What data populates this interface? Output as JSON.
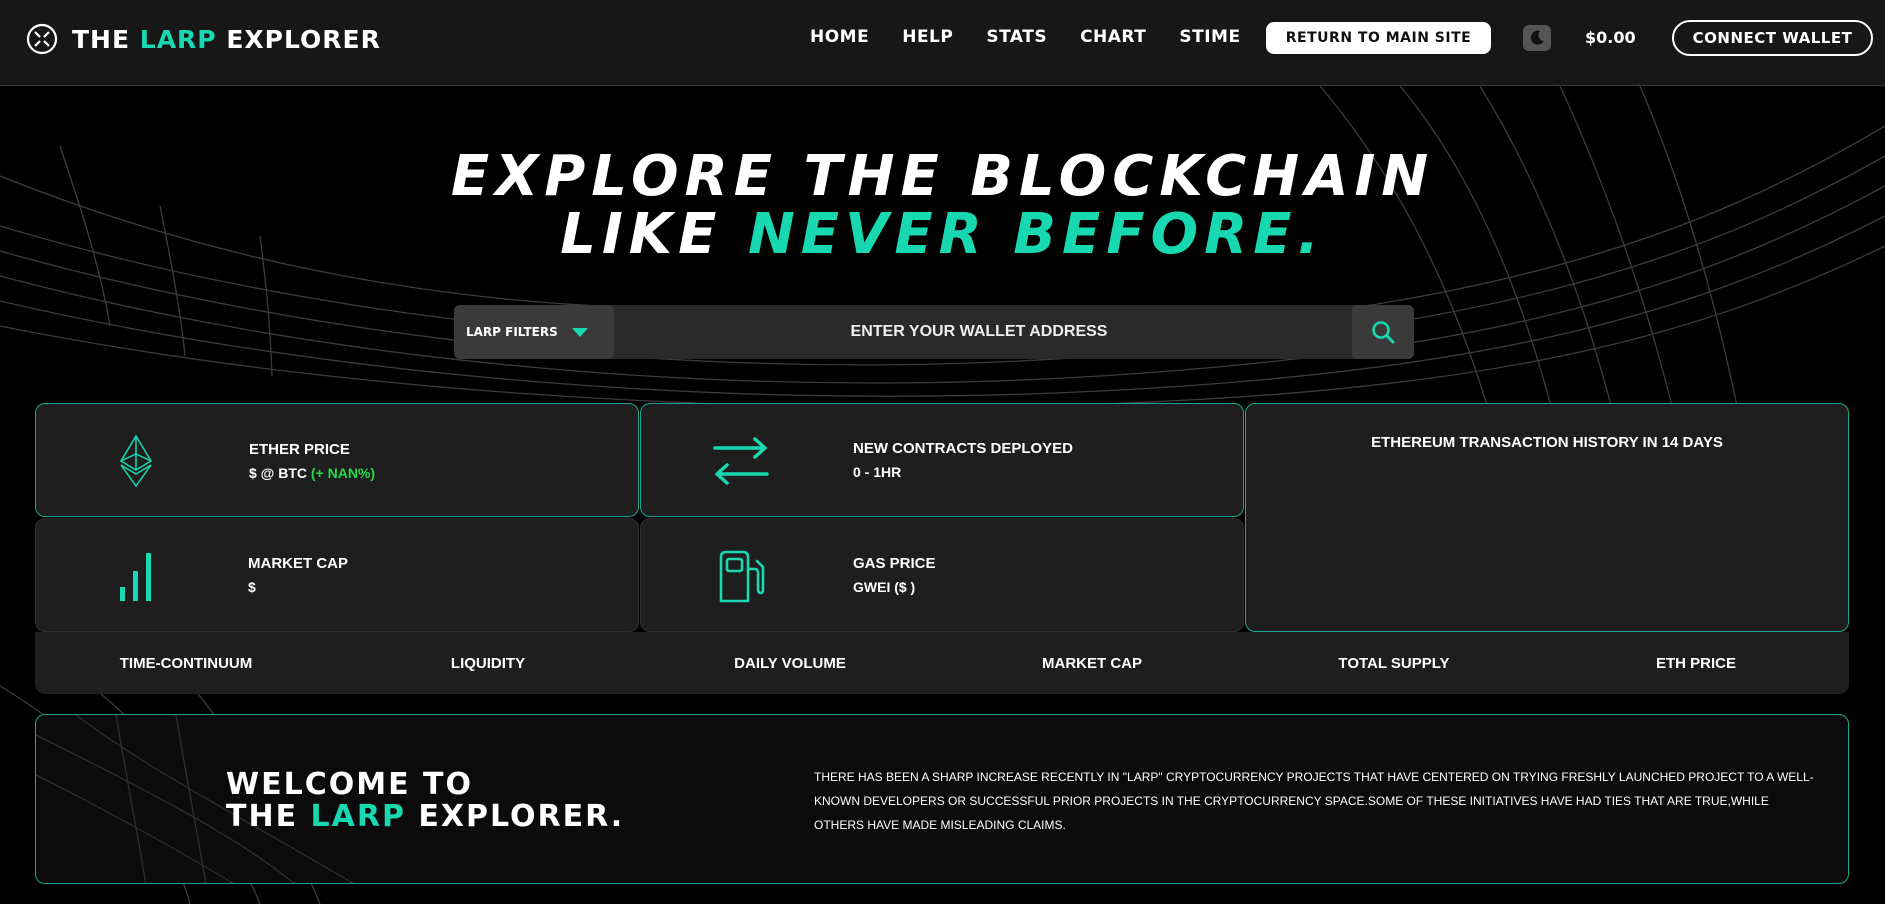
{
  "header": {
    "logo_prefix": "THE ",
    "logo_accent": "LARP",
    "logo_suffix": " EXPLORER",
    "nav": [
      "HOME",
      "HELP",
      "STATS",
      "CHART",
      "STIME"
    ],
    "return_label": "RETURN TO MAIN SITE",
    "balance": "$0.00",
    "connect_label": "CONNECT WALLET"
  },
  "hero": {
    "line1": "EXPLORE THE BLOCKCHAIN",
    "line2_prefix": "LIKE ",
    "line2_accent": "NEVER BEFORE."
  },
  "search": {
    "filters_label": "LARP FILTERS",
    "placeholder": "ENTER YOUR WALLET ADDRESS"
  },
  "stats": {
    "ether_price": {
      "title": "ETHER PRICE",
      "value_prefix": "$ @ BTC ",
      "change": "(+ NAN%)"
    },
    "contracts": {
      "title": "NEW CONTRACTS DEPLOYED",
      "value": "0 - 1HR"
    },
    "market_cap": {
      "title": "MARKET CAP",
      "value": "$"
    },
    "gas_price": {
      "title": "GAS PRICE",
      "value": "GWEI ($ )"
    },
    "history_title": "ETHEREUM TRANSACTION HISTORY IN 14 DAYS"
  },
  "metrics": [
    "TIME-CONTINUUM",
    "LIQUIDITY",
    "DAILY VOLUME",
    "MARKET CAP",
    "TOTAL SUPPLY",
    "ETH PRICE"
  ],
  "welcome": {
    "line1": "WELCOME TO",
    "line2_prefix": "THE ",
    "line2_accent": "LARP",
    "line2_suffix": " EXPLORER.",
    "body": "There has been a sharp increase recently in \"LARP\" cryptocurrency projects that have centered on trying freshly launched project to a well-known developers or successful prior projects in the cryptocurrency space.Some of these initiatives have had ties that are true,while others have made misleading claims."
  },
  "colors": {
    "accent": "#17d8b0",
    "positive": "#22d94a",
    "background": "#000000",
    "panel": "#1e1e1e"
  }
}
